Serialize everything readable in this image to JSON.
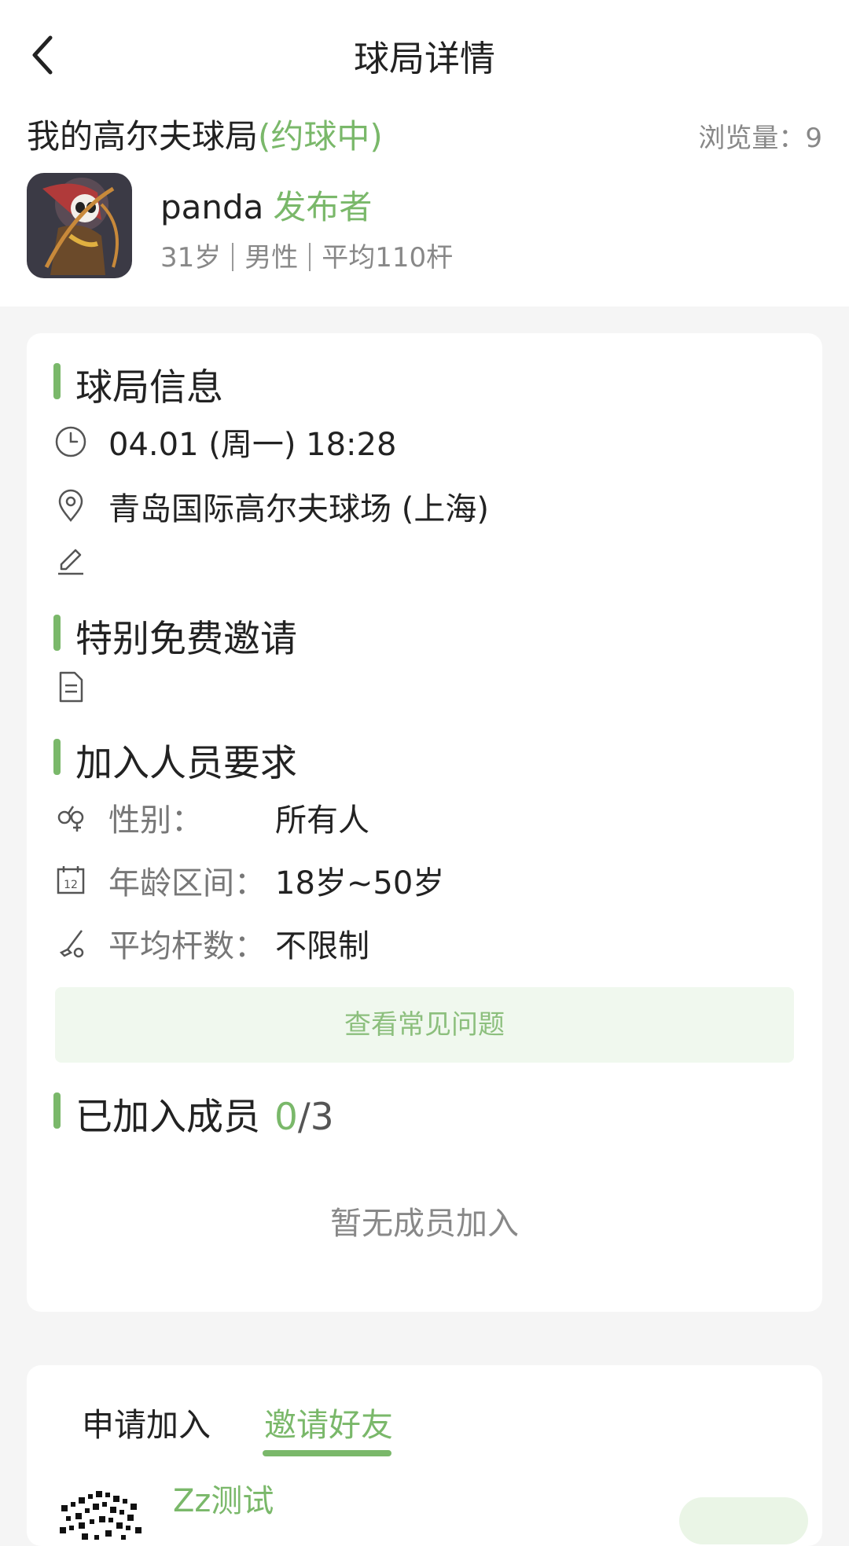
{
  "nav": {
    "title": "球局详情"
  },
  "game": {
    "title": "我的高尔夫球局",
    "status": "(约球中)",
    "views_label": "浏览量：",
    "views_count": "9"
  },
  "publisher": {
    "name": "panda",
    "role": "发布者",
    "age": "31岁",
    "gender": "男性",
    "avg": "平均110杆"
  },
  "info": {
    "section_title": "球局信息",
    "datetime": "04.01 (周一) 18:28",
    "location": "青岛国际高尔夫球场 (上海)"
  },
  "invite": {
    "section_title": "特别免费邀请"
  },
  "requirements": {
    "section_title": "加入人员要求",
    "items": [
      {
        "label": "性别：",
        "value": "所有人"
      },
      {
        "label": "年龄区间：",
        "value": "18岁~50岁"
      },
      {
        "label": "平均杆数：",
        "value": "不限制"
      }
    ]
  },
  "faq_button": "查看常见问题",
  "members": {
    "section_title": "已加入成员",
    "joined": "0",
    "total": "/3",
    "empty_text": "暂无成员加入"
  },
  "tabs": [
    {
      "label": "申请加入",
      "active": false
    },
    {
      "label": "邀请好友",
      "active": true
    }
  ],
  "friend": {
    "name": "Zz测试"
  },
  "colors": {
    "accent": "#7ab86a",
    "background": "#f5f5f5",
    "faq_bg": "#f0f8ee"
  }
}
